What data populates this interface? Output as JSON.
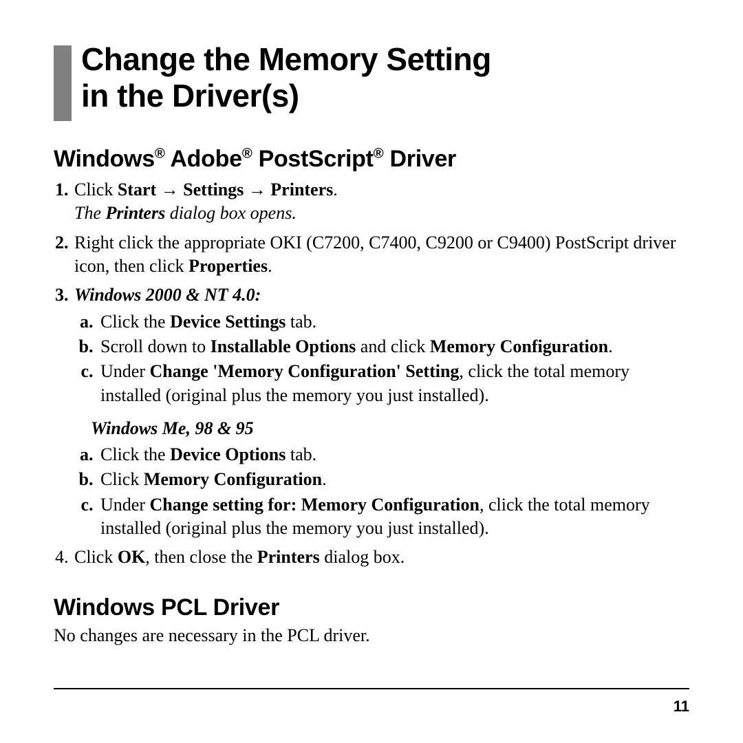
{
  "title_line1": "Change the Memory Setting",
  "title_line2": "in the Driver(s)",
  "section1": {
    "heading_parts": [
      "Windows",
      "®",
      " Adobe",
      "®",
      " PostScript",
      "®",
      " Driver"
    ],
    "step1": {
      "pre": "Click ",
      "b1": "Start",
      "arr": " → ",
      "b2": "Settings",
      "b3": "Printers",
      "dot": ".",
      "result_pre": "The ",
      "result_b": "Printers",
      "result_post": " dialog box opens."
    },
    "step2": {
      "pre": "Right click the appropriate OKI (C7200, C7400, C9200 or C9400) PostScript driver icon, then click ",
      "b": "Properties",
      "dot": "."
    },
    "step3": {
      "heading": "Windows 2000 & NT 4.0:",
      "a": {
        "pre": "Click the ",
        "b": "Device Settings",
        "post": " tab."
      },
      "b": {
        "pre": "Scroll down to ",
        "b1": "Installable Options",
        "mid": " and click ",
        "b2": "Memory Configuration",
        "dot": "."
      },
      "c": {
        "pre": "Under ",
        "b": "Change 'Memory Configuration' Setting",
        "post": ", click the total memory installed (original plus the memory you just installed)."
      }
    },
    "step3b": {
      "heading": "Windows Me, 98 & 95",
      "a": {
        "pre": "Click the ",
        "b": "Device Options",
        "post": " tab."
      },
      "b": {
        "pre": "Click ",
        "b": "Memory Configuration",
        "dot": "."
      },
      "c": {
        "pre": "Under ",
        "b": "Change setting for: Memory Configuration",
        "post": ", click the total memory installed (original plus the memory you just installed)."
      }
    },
    "step4": {
      "pre": "Click ",
      "b1": "OK",
      "mid": ", then close the ",
      "b2": "Printers",
      "post": " dialog box."
    }
  },
  "section2": {
    "heading": "Windows PCL Driver",
    "body": "No changes are necessary in the PCL driver."
  },
  "page_number": "11"
}
